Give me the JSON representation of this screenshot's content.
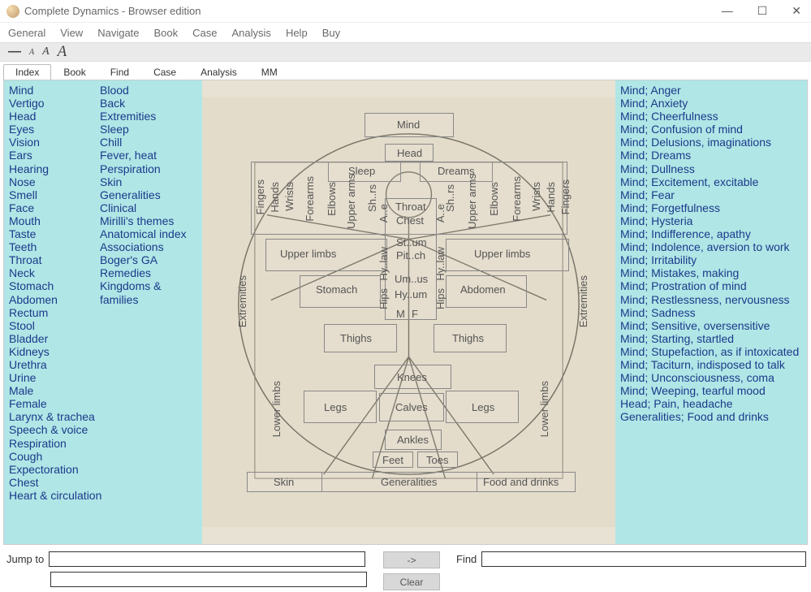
{
  "window": {
    "title": "Complete Dynamics - Browser edition"
  },
  "menu": [
    "General",
    "View",
    "Navigate",
    "Book",
    "Case",
    "Analysis",
    "Help",
    "Buy"
  ],
  "tabs": [
    "Index",
    "Book",
    "Find",
    "Case",
    "Analysis",
    "MM"
  ],
  "active_tab": 0,
  "left_col_a": [
    "Mind",
    "Vertigo",
    "Head",
    "Eyes",
    "Vision",
    "Ears",
    "Hearing",
    "Nose",
    "Smell",
    "Face",
    "Mouth",
    "Taste",
    "Teeth",
    "Throat",
    "Neck",
    "Stomach",
    "Abdomen",
    "Rectum",
    "Stool",
    "Bladder",
    "Kidneys",
    "Urethra",
    "Urine",
    "Male",
    "Female",
    "Larynx & trachea",
    "Speech & voice",
    "Respiration",
    "Cough",
    "Expectoration",
    "Chest",
    "Heart & circulation"
  ],
  "left_col_b": [
    "Blood",
    "Back",
    "Extremities",
    "Sleep",
    "Chill",
    "Fever, heat",
    "Perspiration",
    "Skin",
    "Generalities",
    "Clinical",
    "Mirilli's themes",
    "Anatomical index",
    "Associations",
    "Boger's GA",
    "Remedies",
    "Kingdoms &"
  ],
  "left_col_b_indent": "families",
  "right_items": [
    "Mind; Anger",
    "Mind; Anxiety",
    "Mind; Cheerfulness",
    "Mind; Confusion of mind",
    "Mind; Delusions, imaginations",
    "Mind; Dreams",
    "Mind; Dullness",
    "Mind; Excitement, excitable",
    "Mind; Fear",
    "Mind; Forgetfulness",
    "Mind; Hysteria",
    "Mind; Indifference, apathy",
    "Mind; Indolence, aversion to work",
    "Mind; Irritability",
    "Mind; Mistakes, making",
    "Mind; Prostration of mind",
    "Mind; Restlessness, nervousness",
    "Mind; Sadness",
    "Mind; Sensitive, oversensitive",
    "Mind; Starting, startled",
    "Mind; Stupefaction, as if intoxicated",
    "Mind; Taciturn, indisposed to talk",
    "Mind; Unconsciousness, coma",
    "Mind; Weeping, tearful mood",
    "Head; Pain, headache",
    "Generalities; Food and drinks"
  ],
  "diagram": {
    "mind": "Mind",
    "head": "Head",
    "sleep": "Sleep",
    "dreams": "Dreams",
    "throat": "Throat",
    "chest": "Chest",
    "st_um": "St..um",
    "pit_ch": "Pit..ch",
    "um_us": "Um..us",
    "hy_um": "Hy..um",
    "m": "M",
    "f": "F",
    "stomach": "Stomach",
    "abdomen": "Abdomen",
    "upper_limbs": "Upper limbs",
    "thighs": "Thighs",
    "knees": "Knees",
    "calves": "Calves",
    "legs": "Legs",
    "ankles": "Ankles",
    "feet": "Feet",
    "toes": "Toes",
    "skin": "Skin",
    "generalities": "Generalities",
    "food_drinks": "Food and drinks",
    "extremities": "Extremities",
    "lower_limbs": "Lower limbs",
    "fingers": "Fingers",
    "hands": "Hands",
    "wrists": "Wrists",
    "forearms": "Forearms",
    "elbows": "Elbows",
    "upperarms": "Upper arms",
    "sh_rs": "Sh..rs",
    "axe": "A..e",
    "hips": "Hips",
    "hy_law": "Hy..law"
  },
  "bottom": {
    "jump_label": "Jump to",
    "find_label": "Find",
    "arrow_btn": "->",
    "clear_btn": "Clear"
  }
}
